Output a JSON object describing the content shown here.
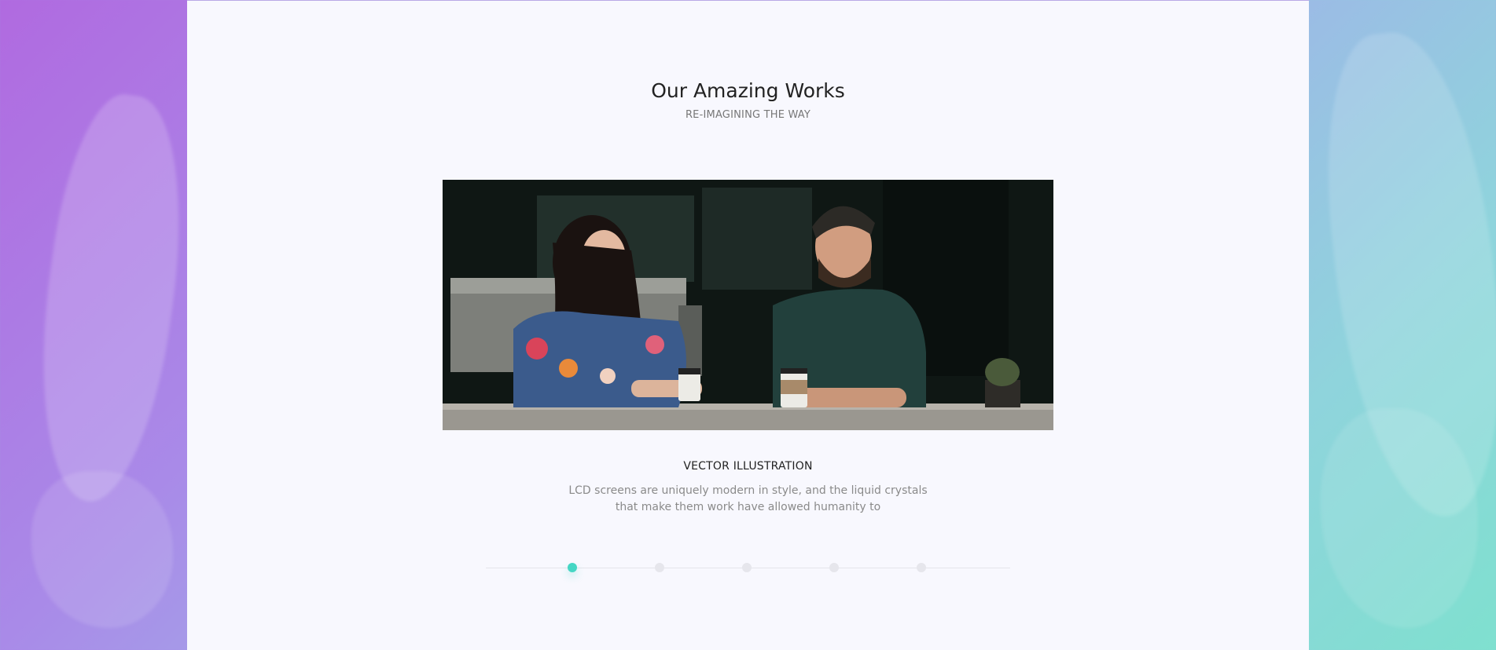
{
  "section": {
    "title": "Our Amazing Works",
    "subtitle": "RE-IMAGINING THE WAY"
  },
  "work": {
    "image_alt": "Two people talking over coffee in a cafe",
    "title": "VECTOR ILLUSTRATION",
    "description": "LCD screens are uniquely modern in style, and the liquid crystals that make them work have allowed humanity to"
  },
  "slider": {
    "total": 5,
    "active_index": 1
  },
  "colors": {
    "accent": "#45d6c4",
    "panel": "#f8f8fe",
    "dot_inactive": "#e6e6ec"
  }
}
